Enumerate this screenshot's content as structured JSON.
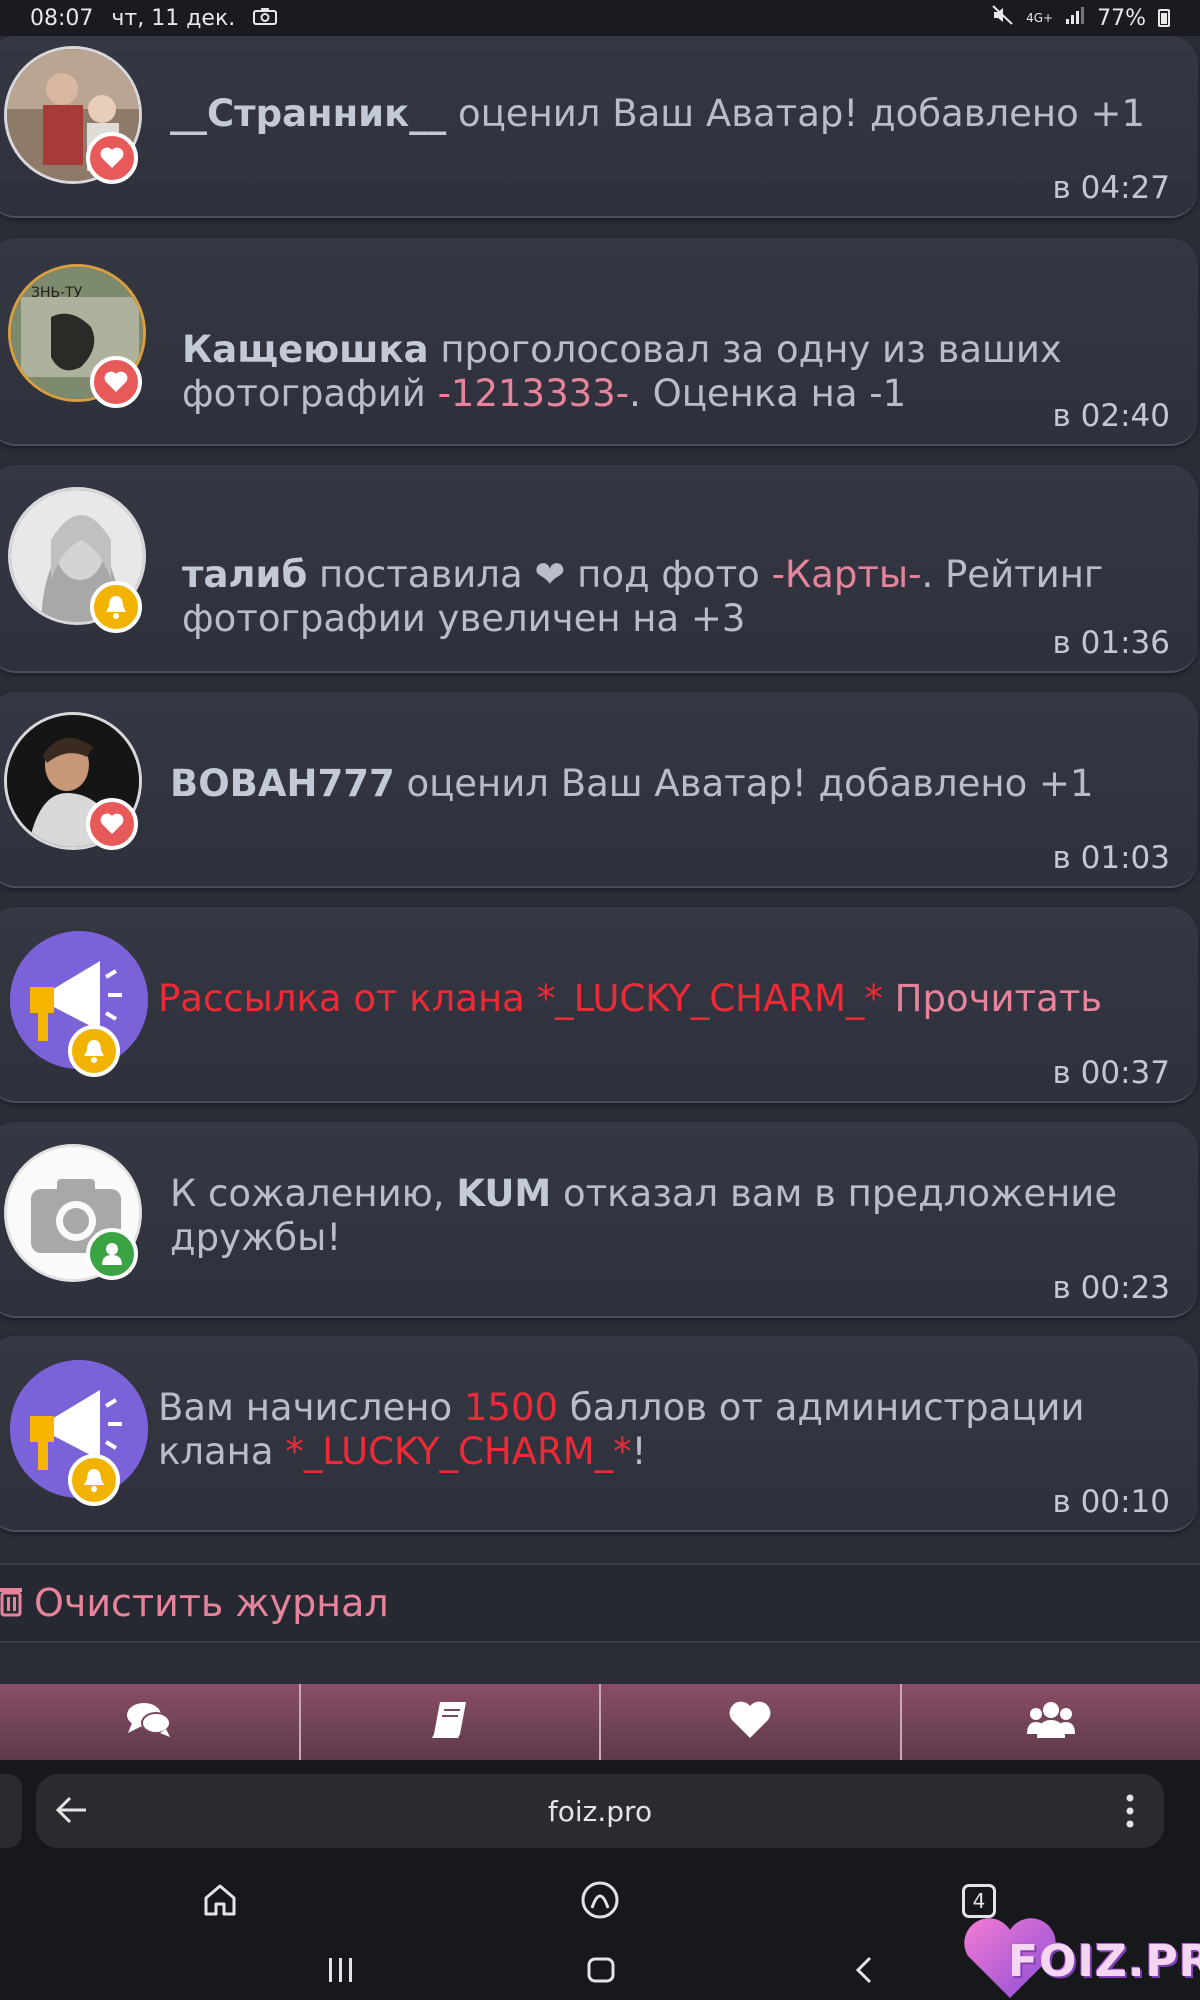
{
  "status_bar": {
    "time": "08:07",
    "date": "чт, 11 дек.",
    "battery": "77%",
    "network": "4G+"
  },
  "notifications": [
    {
      "parts": [
        {
          "text": "__Странник__",
          "style": "bold"
        },
        {
          "text": " оценил Ваш Аватар! добавлено +1",
          "style": "normal"
        }
      ],
      "time": "в 04:27",
      "badge": "heart-icon"
    },
    {
      "parts": [
        {
          "text": "Кащеюшка",
          "style": "bold"
        },
        {
          "text": " проголосовал за одну из ваших фотографий ",
          "style": "normal"
        },
        {
          "text": "-1213333-",
          "style": "pink"
        },
        {
          "text": ". Оценка на -1",
          "style": "normal"
        }
      ],
      "time": "в 02:40",
      "badge": "heart-icon"
    },
    {
      "parts": [
        {
          "text": "талиб",
          "style": "bold"
        },
        {
          "text": " поставила ",
          "style": "normal"
        },
        {
          "text": "❤",
          "style": "normal"
        },
        {
          "text": " под фото ",
          "style": "normal"
        },
        {
          "text": "-Карты-",
          "style": "pink"
        },
        {
          "text": ". Рейтинг фотографии увеличен на +3",
          "style": "normal"
        }
      ],
      "time": "в 01:36",
      "badge": "bell-icon"
    },
    {
      "parts": [
        {
          "text": "BOBAH777",
          "style": "bold"
        },
        {
          "text": " оценил Ваш Аватар! добавлено +1",
          "style": "normal"
        }
      ],
      "time": "в 01:03",
      "badge": "heart-icon"
    },
    {
      "parts": [
        {
          "text": "Рассылка от клана *_LUCKY_CHARM_*",
          "style": "red"
        },
        {
          "text": " Прочитать",
          "style": "pink"
        }
      ],
      "time": "в 00:37",
      "badge": "bell-icon"
    },
    {
      "parts": [
        {
          "text": "К сожалению, ",
          "style": "normal"
        },
        {
          "text": "KUM",
          "style": "bold"
        },
        {
          "text": " отказал вам в предложение дружбы!",
          "style": "normal"
        }
      ],
      "time": "в 00:23",
      "badge": "user-icon"
    },
    {
      "parts": [
        {
          "text": "Вам начислено ",
          "style": "normal"
        },
        {
          "text": "1500",
          "style": "red"
        },
        {
          "text": " баллов от администрации клана ",
          "style": "normal"
        },
        {
          "text": "*_LUCKY_CHARM_*",
          "style": "red"
        },
        {
          "text": "!",
          "style": "normal"
        }
      ],
      "time": "в 00:10",
      "badge": "bell-icon"
    }
  ],
  "clear_log": {
    "label": "Очистить журнал",
    "icon": "trash-icon"
  },
  "bottom_nav": [
    {
      "icon": "chat-icon"
    },
    {
      "icon": "book-icon"
    },
    {
      "icon": "heart-icon"
    },
    {
      "icon": "users-icon"
    }
  ],
  "browser": {
    "url": "foiz.pro",
    "tab_count": "4"
  },
  "watermark": {
    "text": "FOIZ.PRO"
  },
  "colors": {
    "background": "#2a2d36",
    "pink": "#e7849c",
    "red": "#ee2a36",
    "nav": "#8a4e67"
  }
}
